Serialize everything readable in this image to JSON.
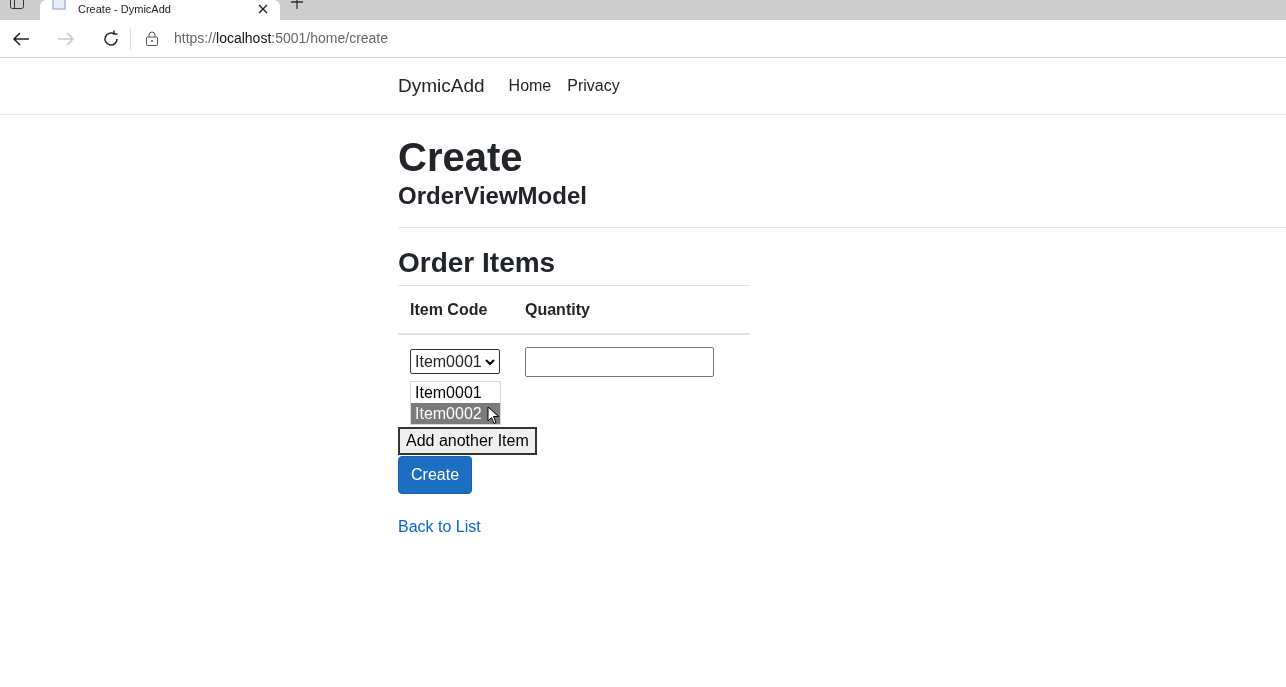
{
  "browser": {
    "tab_title": "Create - DymicAdd",
    "url_prefix": "https://",
    "url_host": "localhost",
    "url_rest": ":5001/home/create"
  },
  "navbar": {
    "brand": "DymicAdd",
    "links": [
      "Home",
      "Privacy"
    ]
  },
  "heading": "Create",
  "subheading": "OrderViewModel",
  "section_title": "Order Items",
  "table": {
    "columns": [
      "Item Code",
      "Quantity"
    ],
    "rows": [
      {
        "item_code": "Item0001",
        "quantity": ""
      }
    ]
  },
  "dropdown": {
    "options": [
      {
        "label": "Item0001",
        "selected": false
      },
      {
        "label": "Item0002",
        "selected": true
      }
    ]
  },
  "add_button": "Add another Item",
  "submit_button": "Create",
  "back_link": "Back to List"
}
